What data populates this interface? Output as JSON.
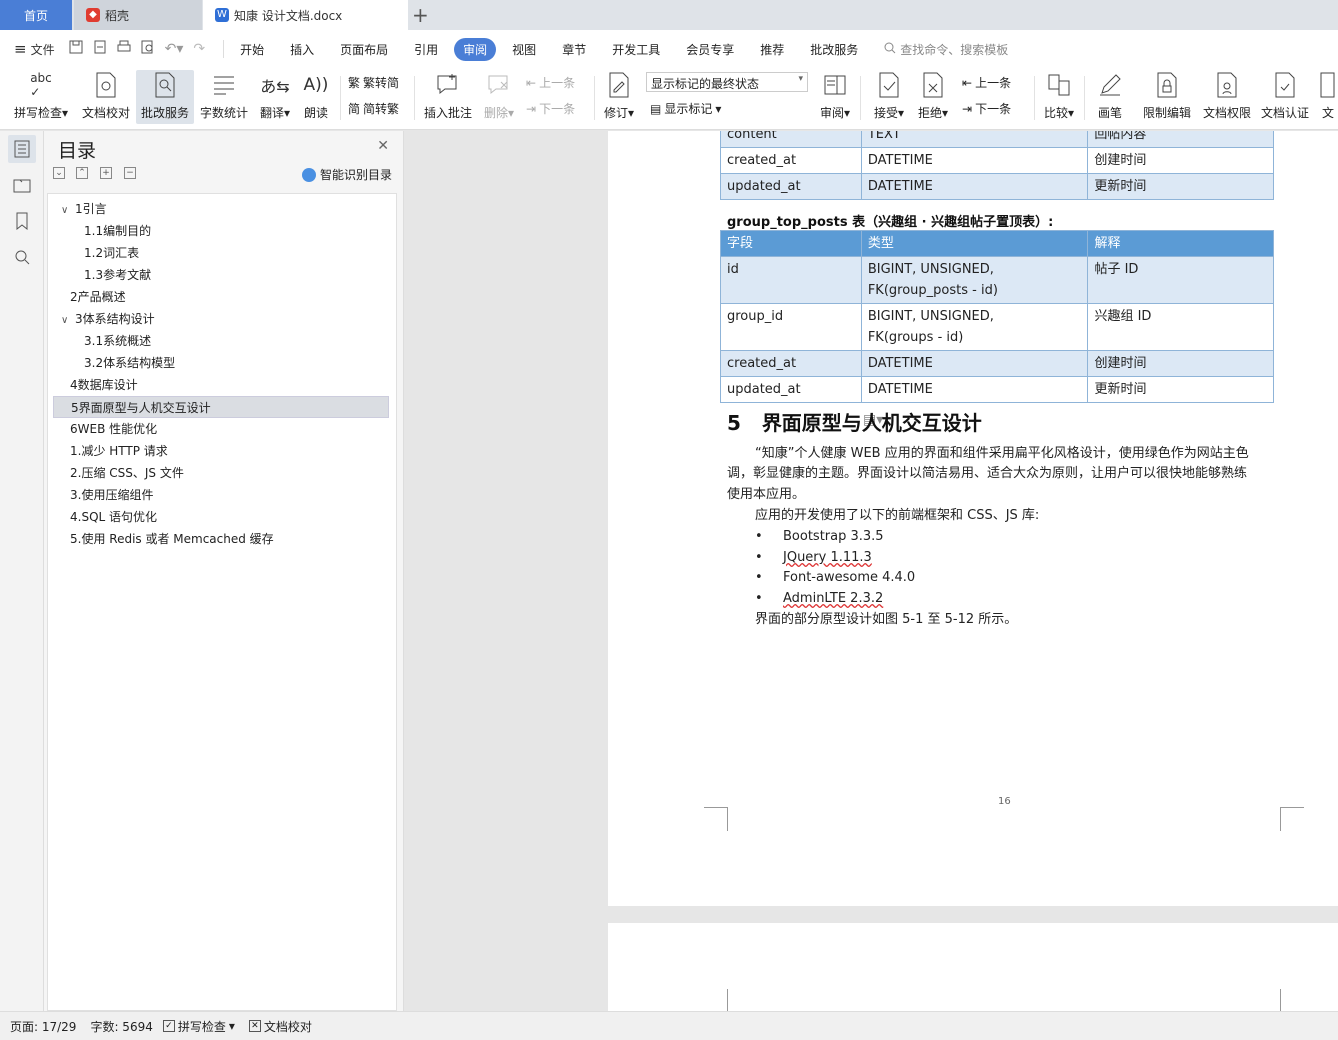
{
  "tabs": {
    "home": "首页",
    "daoke": "稻壳",
    "doc": "知康 设计文档.docx"
  },
  "menu": {
    "file": "文件",
    "items": [
      "开始",
      "插入",
      "页面布局",
      "引用",
      "审阅",
      "视图",
      "章节",
      "开发工具",
      "会员专享",
      "推荐",
      "批改服务"
    ],
    "active": "审阅",
    "search": "查找命令、搜索模板"
  },
  "ribbon": {
    "spell": "拼写检查",
    "proofread": "文档校对",
    "correct": "批改服务",
    "wordcount": "字数统计",
    "translate": "翻译",
    "read": "朗读",
    "to_simplified": "繁转简",
    "to_traditional": "简转繁",
    "insert_comment": "插入批注",
    "delete": "删除",
    "prev_comment": "上一条",
    "next_comment": "下一条",
    "revise": "修订",
    "markup_state": "显示标记的最终状态",
    "show_markup": "显示标记",
    "review": "审阅",
    "accept": "接受",
    "reject": "拒绝",
    "prev": "上一条",
    "next": "下一条",
    "compare": "比较",
    "pen": "画笔",
    "restrict": "限制编辑",
    "permission": "文档权限",
    "certify": "文档认证",
    "more": "文"
  },
  "toc": {
    "title": "目录",
    "smart": "智能识别目录",
    "items": [
      {
        "label": "1引言",
        "level": 1,
        "expanded": true
      },
      {
        "label": "1.1编制目的",
        "level": 2
      },
      {
        "label": "1.2词汇表",
        "level": 2
      },
      {
        "label": "1.3参考文献",
        "level": 2
      },
      {
        "label": "2产品概述",
        "level": 1
      },
      {
        "label": "3体系结构设计",
        "level": 1,
        "expanded": true
      },
      {
        "label": "3.1系统概述",
        "level": 2
      },
      {
        "label": "3.2体系结构模型",
        "level": 2
      },
      {
        "label": "4数据库设计",
        "level": 1
      },
      {
        "label": "5界面原型与人机交互设计",
        "level": 1,
        "selected": true
      },
      {
        "label": "6WEB 性能优化",
        "level": 1
      },
      {
        "label": "1.减少 HTTP 请求",
        "level": 1
      },
      {
        "label": "2.压缩 CSS、JS 文件",
        "level": 1
      },
      {
        "label": "3.使用压缩组件",
        "level": 1
      },
      {
        "label": "4.SQL 语句优化",
        "level": 1
      },
      {
        "label": "5.使用 Redis 或者 Memcached 缓存",
        "level": 1
      }
    ]
  },
  "doc": {
    "table1": [
      [
        "content",
        "TEXT",
        "回帖内容"
      ],
      [
        "created_at",
        "DATETIME",
        "创建时间"
      ],
      [
        "updated_at",
        "DATETIME",
        "更新时间"
      ]
    ],
    "caption": "group_top_posts 表（兴趣组 · 兴趣组帖子置顶表）:",
    "table2_head": [
      "字段",
      "类型",
      "解释"
    ],
    "table2": [
      [
        "id",
        "BIGINT, UNSIGNED,",
        "FK(group_posts - id)",
        "帖子 ID"
      ],
      [
        "group_id",
        "BIGINT, UNSIGNED,",
        "FK(groups - id)",
        "兴趣组 ID"
      ],
      [
        "created_at",
        "DATETIME",
        "",
        "创建时间"
      ],
      [
        "updated_at",
        "DATETIME",
        "",
        "更新时间"
      ]
    ],
    "section_no": "5",
    "section_title": "界面原型与人机交互设计",
    "para1_line1": "“知康”个人健康 WEB 应用的界面和组件采用扁平化风格设计，使用绿色作为网站主色",
    "para1_line2": "调，彰显健康的主题。界面设计以简洁易用、适合大众为原则，让用户可以很快地能够熟练",
    "para1_line3": "使用本应用。",
    "para2": "应用的开发使用了以下的前端框架和 CSS、JS 库:",
    "bullets": [
      "Bootstrap 3.3.5",
      "JQuery 1.11.3",
      "Font-awesome 4.4.0",
      "AdminLTE 2.3.2"
    ],
    "para3": "界面的部分原型设计如图 5-1 至 5-12 所示。",
    "page_number": "16"
  },
  "status": {
    "page": "页面: 17/29",
    "words": "字数: 5694",
    "spell": "拼写检查",
    "proofread": "文档校对"
  },
  "colors": {
    "accent": "#4a7ed6",
    "table_header": "#5b9bd5",
    "table_alt": "#dce8f5"
  }
}
